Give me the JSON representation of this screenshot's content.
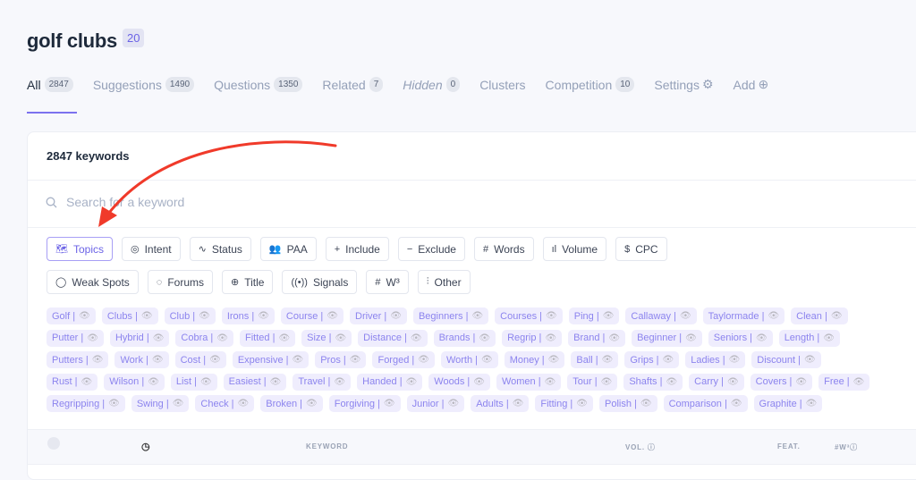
{
  "header": {
    "title": "golf clubs",
    "badge": "20"
  },
  "tabs": [
    {
      "label": "All",
      "count": "2847",
      "active": true
    },
    {
      "label": "Suggestions",
      "count": "1490"
    },
    {
      "label": "Questions",
      "count": "1350"
    },
    {
      "label": "Related",
      "count": "7"
    },
    {
      "label": "Hidden",
      "count": "0"
    },
    {
      "label": "Clusters"
    },
    {
      "label": "Competition",
      "count": "10"
    },
    {
      "label": "Settings",
      "icon": "⚙"
    },
    {
      "label": "Add",
      "icon": "⊕"
    }
  ],
  "card": {
    "keyword_count": "2847 keywords",
    "search_placeholder": "Search for a keyword"
  },
  "filters_row1": [
    {
      "icon": "🗺",
      "label": "Topics"
    },
    {
      "icon": "◎",
      "label": "Intent"
    },
    {
      "icon": "∿",
      "label": "Status"
    },
    {
      "icon": "👥",
      "label": "PAA"
    },
    {
      "icon": "+",
      "label": "Include"
    },
    {
      "icon": "−",
      "label": "Exclude"
    },
    {
      "icon": "#",
      "label": "Words"
    },
    {
      "icon": "ıl",
      "label": "Volume"
    },
    {
      "icon": "$",
      "label": "CPC"
    }
  ],
  "filters_row2": [
    {
      "icon": "◯",
      "label": "Weak Spots"
    },
    {
      "icon": "◌",
      "label": "Forums"
    },
    {
      "icon": "⊕",
      "label": "Title"
    },
    {
      "icon": "((•))",
      "label": "Signals"
    },
    {
      "icon": "#",
      "label": "W³"
    },
    {
      "icon": "⫶",
      "label": "Other"
    }
  ],
  "tag_rows": [
    [
      "Golf",
      "Clubs",
      "Club",
      "Irons",
      "Course",
      "Driver",
      "Beginners",
      "Courses",
      "Ping",
      "Callaway",
      "Taylormade",
      "Clean"
    ],
    [
      "Putter",
      "Hybrid",
      "Cobra",
      "Fitted",
      "Size",
      "Distance",
      "Brands",
      "Regrip",
      "Brand",
      "Beginner",
      "Seniors",
      "Length"
    ],
    [
      "Putters",
      "Work",
      "Cost",
      "Expensive",
      "Pros",
      "Forged",
      "Worth",
      "Money",
      "Ball",
      "Grips",
      "Ladies",
      "Discount"
    ],
    [
      "Rust",
      "Wilson",
      "List",
      "Easiest",
      "Travel",
      "Handed",
      "Woods",
      "Women",
      "Tour",
      "Shafts",
      "Carry",
      "Covers",
      "Free"
    ],
    [
      "Regripping",
      "Swing",
      "Check",
      "Broken",
      "Forgiving",
      "Junior",
      "Adults",
      "Fitting",
      "Polish",
      "Comparison",
      "Graphite"
    ]
  ],
  "table_header": {
    "keyword": "KEYWORD",
    "vol": "VOL.",
    "feat": "FEAT.",
    "words": "#W³"
  },
  "colors": {
    "accent": "#6b63e6",
    "tag_bg": "#efedfd",
    "tag_text": "#8c84ee",
    "arrow": "#f03a2a"
  }
}
